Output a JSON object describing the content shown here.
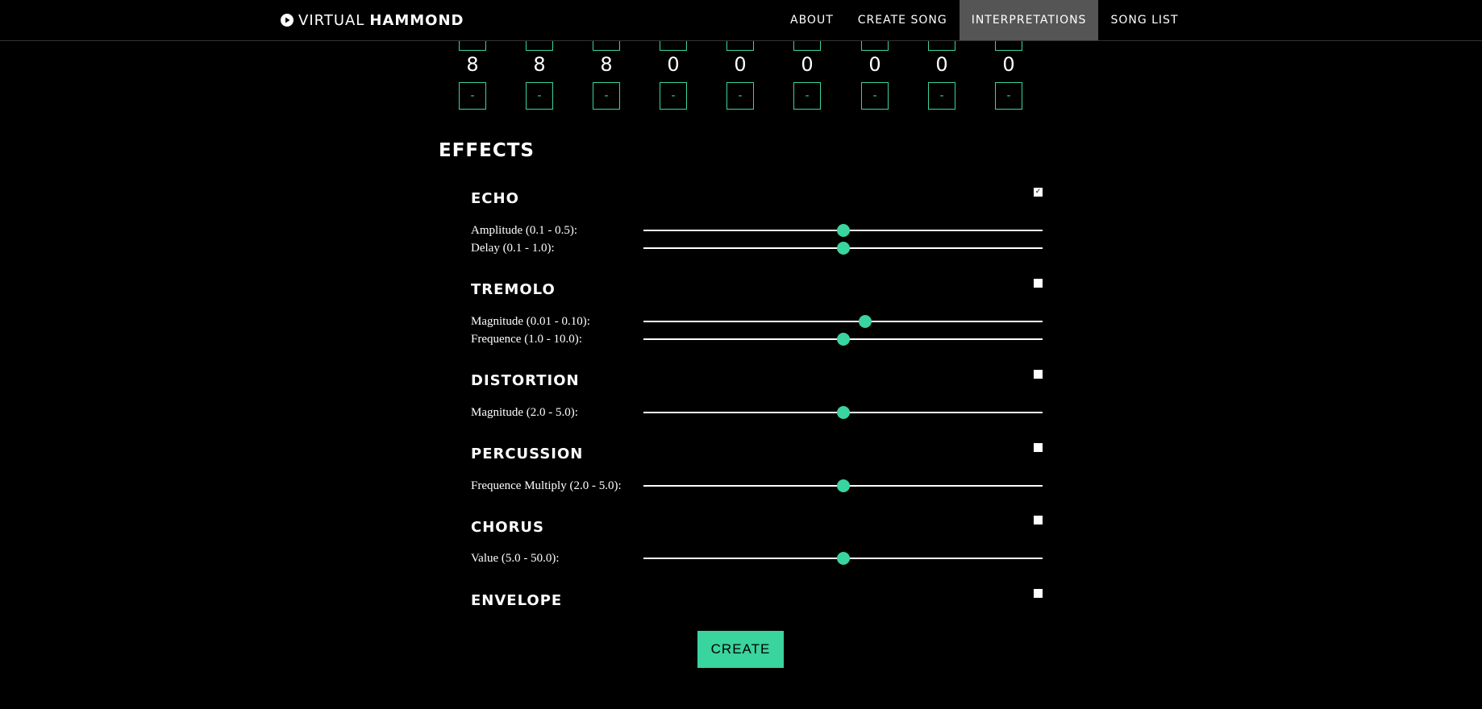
{
  "navbar": {
    "brand_light": "VIRTUAL",
    "brand_bold": "HAMMOND",
    "items": [
      {
        "label": "ABOUT"
      },
      {
        "label": "CREATE SONG"
      },
      {
        "label": "INTERPRETATIONS",
        "active": true
      },
      {
        "label": "SONG LIST"
      }
    ]
  },
  "drawbars": {
    "values": [
      "8",
      "8",
      "8",
      "0",
      "0",
      "0",
      "0",
      "0",
      "0"
    ],
    "minus_label": "-"
  },
  "effects": {
    "heading": "EFFECTS",
    "list": [
      {
        "title": "ECHO",
        "checked": true,
        "params": [
          {
            "label": "Amplitude (0.1 - 0.5):",
            "value": 0.3,
            "min": 0.1,
            "max": 0.5
          },
          {
            "label": "Delay (0.1 - 1.0):",
            "value": 0.55,
            "min": 0.1,
            "max": 1.0
          }
        ]
      },
      {
        "title": "TREMOLO",
        "checked": false,
        "params": [
          {
            "label": "Magnitude (0.01 - 0.10):",
            "value": 0.06,
            "min": 0.01,
            "max": 0.1
          },
          {
            "label": "Frequence (1.0 - 10.0):",
            "value": 5.5,
            "min": 1.0,
            "max": 10.0
          }
        ]
      },
      {
        "title": "DISTORTION",
        "checked": false,
        "params": [
          {
            "label": "Magnitude (2.0 - 5.0):",
            "value": 3.5,
            "min": 2.0,
            "max": 5.0
          }
        ]
      },
      {
        "title": "PERCUSSION",
        "checked": false,
        "params": [
          {
            "label": "Frequence Multiply (2.0 - 5.0):",
            "value": 3.5,
            "min": 2.0,
            "max": 5.0
          }
        ]
      },
      {
        "title": "CHORUS",
        "checked": false,
        "params": [
          {
            "label": "Value (5.0 - 50.0):",
            "value": 27.5,
            "min": 5.0,
            "max": 50.0
          }
        ]
      },
      {
        "title": "ENVELOPE",
        "checked": false,
        "params": []
      }
    ]
  },
  "create_label": "CREATE",
  "colors": {
    "accent": "#3ad49e",
    "nav_active": "#555555",
    "background": "#000000"
  }
}
